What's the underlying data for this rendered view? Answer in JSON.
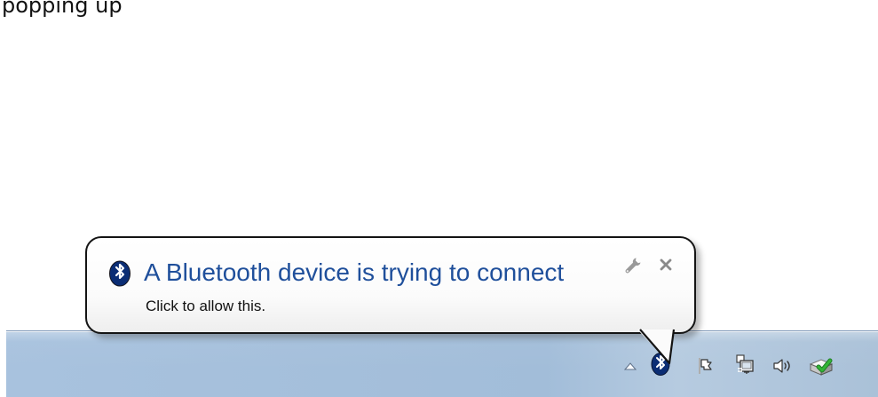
{
  "page": {
    "partial_text": "popping up"
  },
  "notification": {
    "title": "A Bluetooth device is trying to connect",
    "message": "Click to allow this.",
    "icon": "bluetooth-icon",
    "settings_icon": "wrench-icon",
    "close_icon": "close-icon"
  },
  "taskbar": {
    "tray_icons": [
      "show-hidden-icons-icon",
      "bluetooth-icon",
      "action-center-flag-icon",
      "network-icon",
      "volume-icon",
      "device-checkmark-icon"
    ]
  },
  "colors": {
    "notification_title": "#1f4f9b",
    "taskbar": "#a8c2de",
    "bluetooth": "#0b2d74",
    "checkmark": "#33b536"
  }
}
